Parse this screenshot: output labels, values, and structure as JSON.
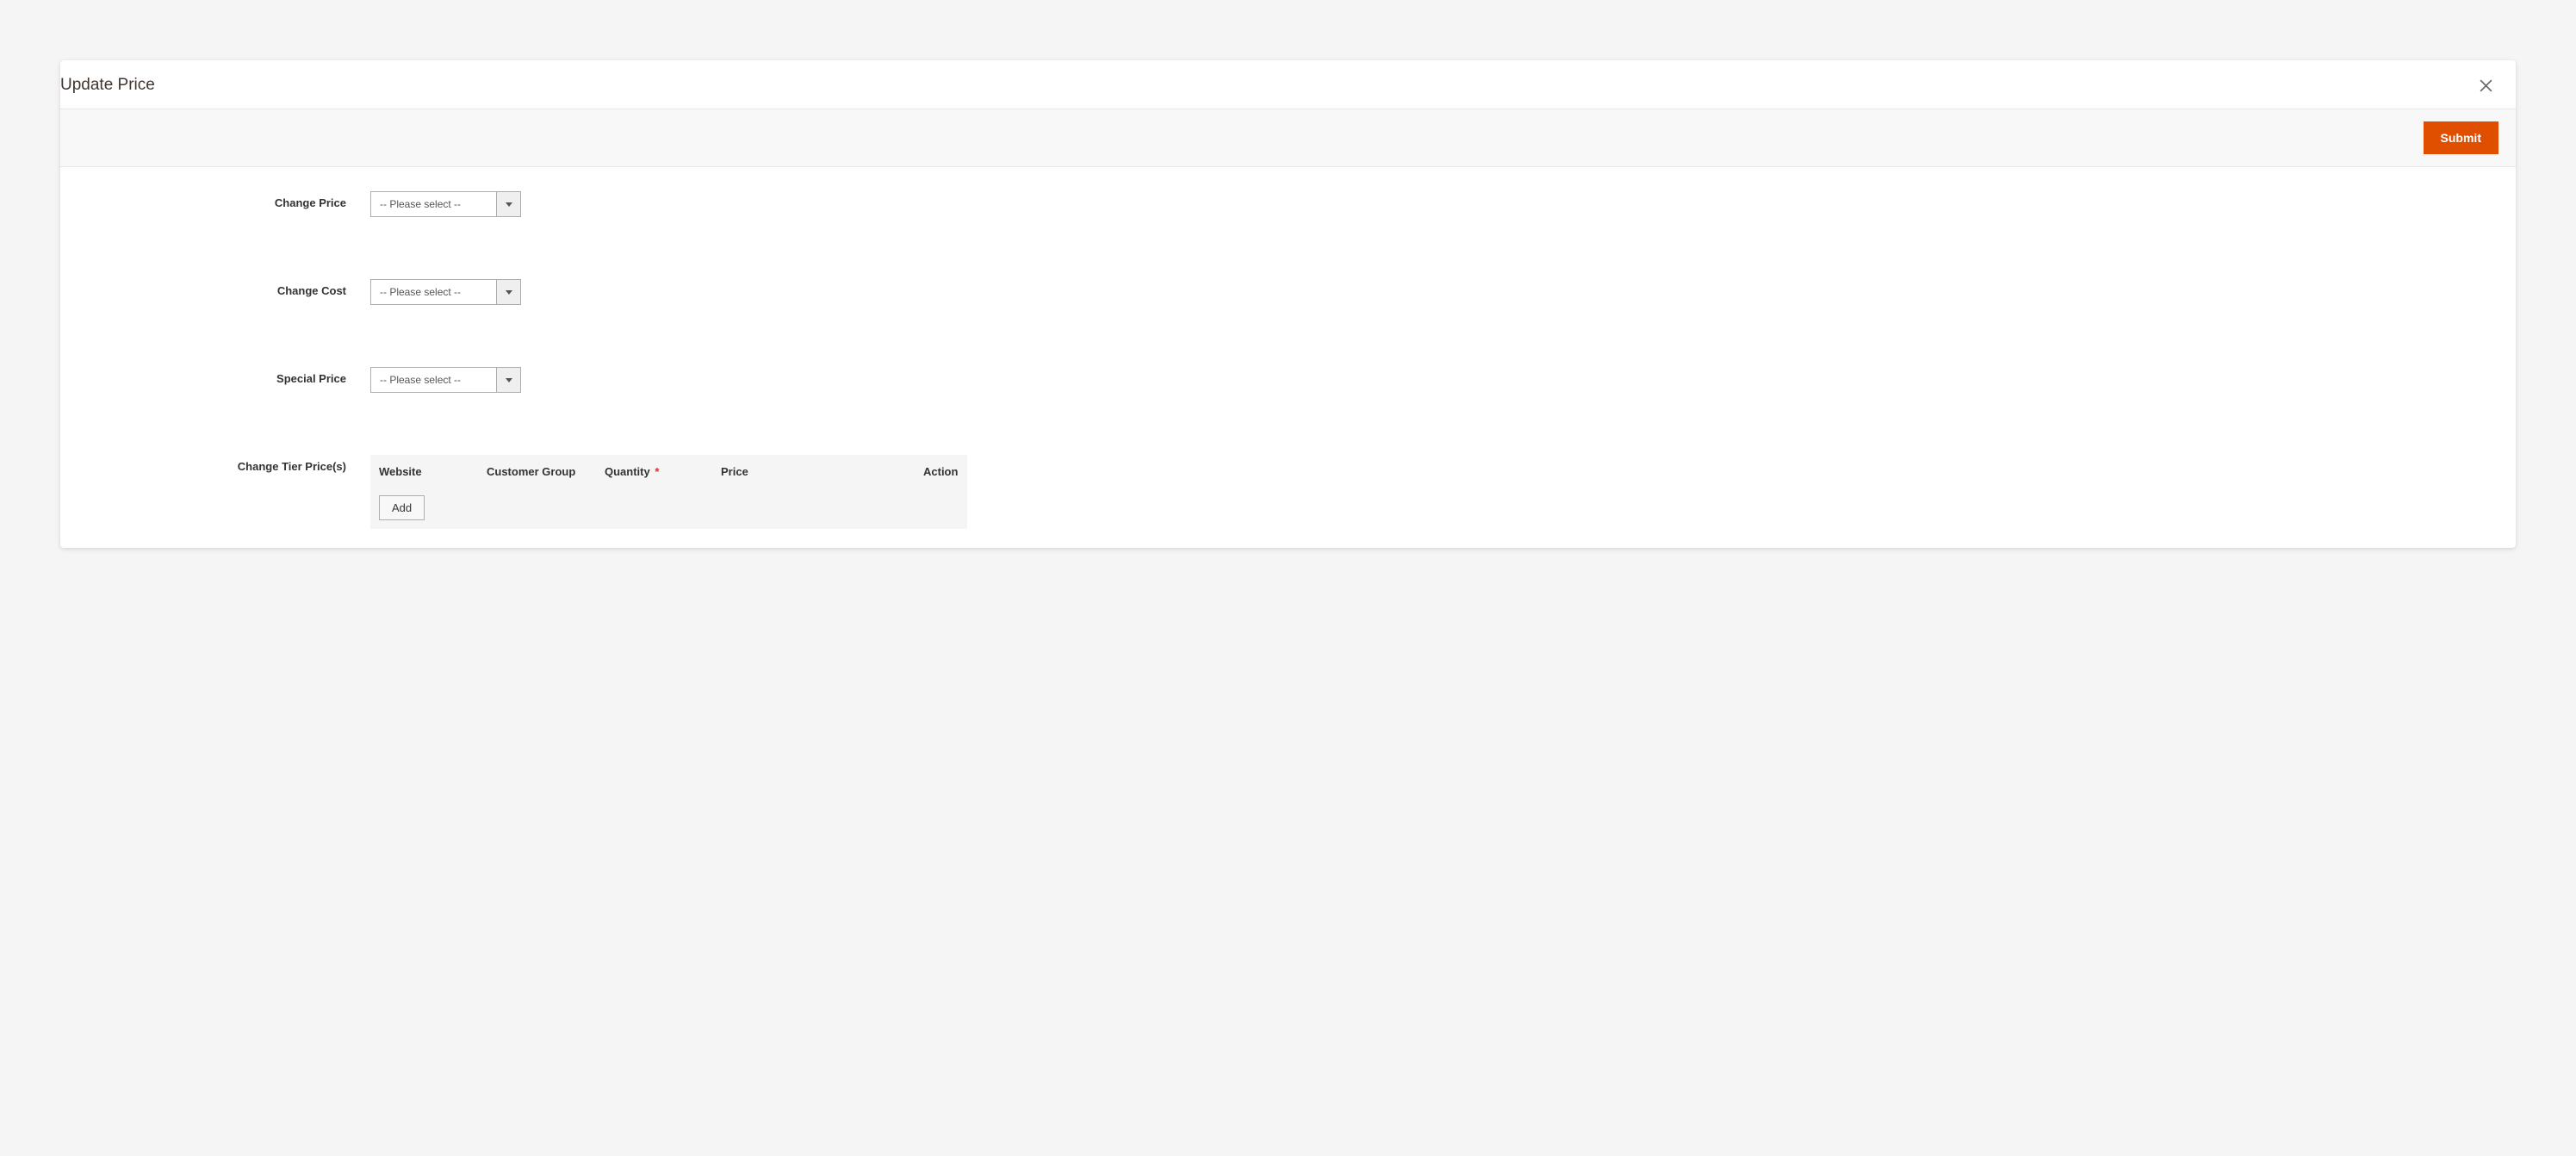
{
  "modal": {
    "title": "Update Price"
  },
  "toolbar": {
    "submit_label": "Submit"
  },
  "form": {
    "change_price": {
      "label": "Change Price",
      "selected": "-- Please select --"
    },
    "change_cost": {
      "label": "Change Cost",
      "selected": "-- Please select --"
    },
    "special_price": {
      "label": "Special Price",
      "selected": "-- Please select --"
    },
    "tier_price": {
      "label": "Change Tier Price(s)",
      "columns": {
        "website": "Website",
        "customer_group": "Customer Group",
        "quantity": "Quantity",
        "price": "Price",
        "action": "Action"
      },
      "required_marker": "*",
      "add_label": "Add"
    }
  }
}
